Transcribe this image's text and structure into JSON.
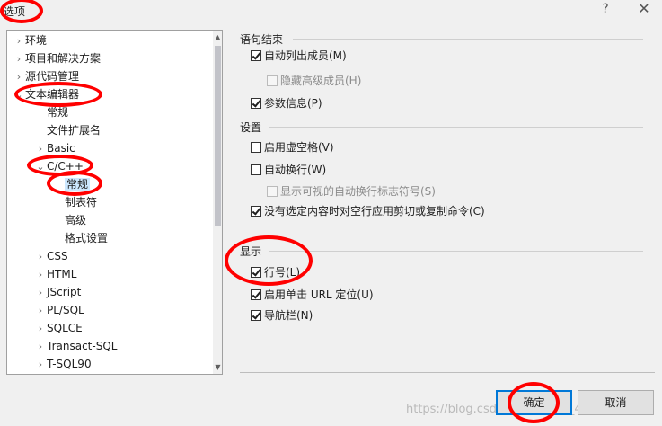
{
  "window": {
    "title": "选项",
    "help_icon": "?",
    "close_icon": "✕"
  },
  "tree": {
    "items": [
      {
        "label": "环境",
        "arrow": "›"
      },
      {
        "label": "项目和解决方案",
        "arrow": "›"
      },
      {
        "label": "源代码管理",
        "arrow": "›"
      },
      {
        "label": "文本编辑器",
        "arrow": "⌄"
      },
      {
        "label": "常规",
        "arrow": ""
      },
      {
        "label": "文件扩展名",
        "arrow": ""
      },
      {
        "label": "Basic",
        "arrow": "›"
      },
      {
        "label": "C/C++",
        "arrow": "⌄"
      },
      {
        "label": "常规",
        "arrow": ""
      },
      {
        "label": "制表符",
        "arrow": ""
      },
      {
        "label": "高级",
        "arrow": ""
      },
      {
        "label": "格式设置",
        "arrow": ""
      },
      {
        "label": "CSS",
        "arrow": "›"
      },
      {
        "label": "HTML",
        "arrow": "›"
      },
      {
        "label": "JScript",
        "arrow": "›"
      },
      {
        "label": "PL/SQL",
        "arrow": "›"
      },
      {
        "label": "SQLCE",
        "arrow": "›"
      },
      {
        "label": "Transact-SQL",
        "arrow": "›"
      },
      {
        "label": "T-SQL90",
        "arrow": "›"
      }
    ],
    "scroll_up": "▲",
    "scroll_down": "▼"
  },
  "sections": {
    "statement_completion": "语句结束",
    "settings": "设置",
    "display": "显示"
  },
  "options": {
    "auto_list_members": {
      "label": "自动列出成员(M)",
      "checked": true
    },
    "hide_advanced_members": {
      "label": "隐藏高级成员(H)",
      "checked": false
    },
    "parameter_info": {
      "label": "参数信息(P)",
      "checked": true
    },
    "enable_virtual_space": {
      "label": "启用虚空格(V)",
      "checked": false
    },
    "word_wrap": {
      "label": "自动换行(W)",
      "checked": false
    },
    "show_wrap_glyphs": {
      "label": "显示可视的自动换行标志符号(S)",
      "checked": false
    },
    "copy_cut_blank_line": {
      "label": "没有选定内容时对空行应用剪切或复制命令(C)",
      "checked": true
    },
    "line_numbers": {
      "label": "行号(L)",
      "checked": true
    },
    "single_click_url": {
      "label": "启用单击 URL 定位(U)",
      "checked": true
    },
    "navigation_bar": {
      "label": "导航栏(N)",
      "checked": true
    }
  },
  "buttons": {
    "ok": "确定",
    "cancel": "取消"
  },
  "watermark": "https://blog.csdn.net/weixin_42107898",
  "colors": {
    "annotation": "#ff0000",
    "selection": "#cce8ff",
    "accent": "#0078d7"
  }
}
